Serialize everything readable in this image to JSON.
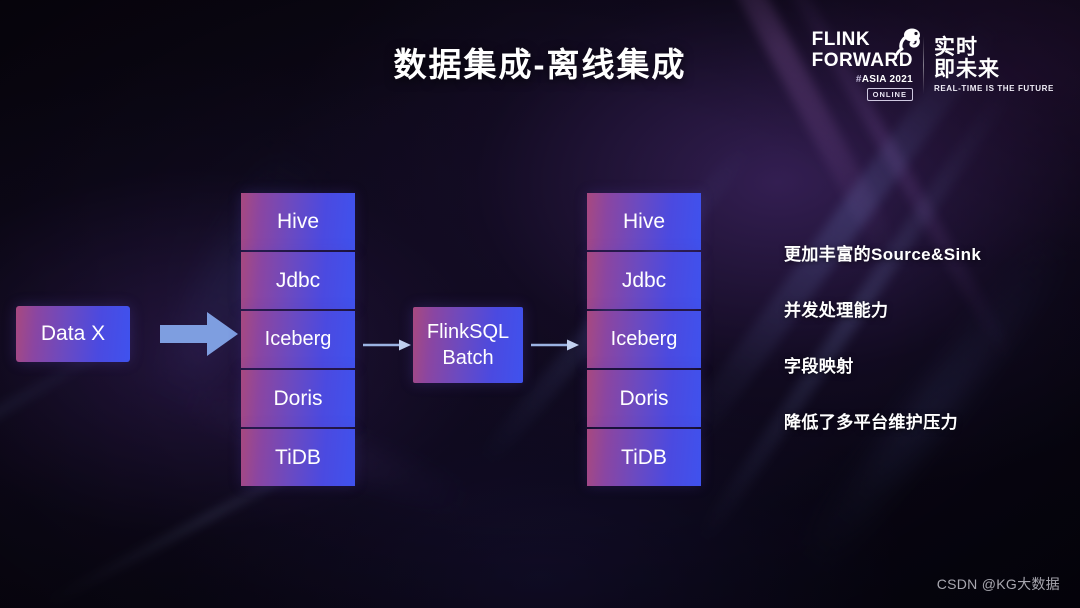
{
  "slide": {
    "title": "数据集成-离线集成",
    "watermark": "CSDN @KG大数据"
  },
  "logo": {
    "word1": "FLINK",
    "word2": "FORWARD",
    "hash": "#",
    "event": "ASIA 2021",
    "online": "ONLINE",
    "cn_line1": "实时",
    "cn_line2": "即未来",
    "tagline": "REAL-TIME IS THE FUTURE"
  },
  "diagram": {
    "source_box": "Data X",
    "engine_box_line1": "FlinkSQL",
    "engine_box_line2": "Batch",
    "left_stack": [
      {
        "label": "Hive"
      },
      {
        "label": "Jdbc"
      },
      {
        "label": "Iceberg"
      },
      {
        "label": "Doris"
      },
      {
        "label": "TiDB"
      }
    ],
    "right_stack": [
      {
        "label": "Hive"
      },
      {
        "label": "Jdbc"
      },
      {
        "label": "Iceberg"
      },
      {
        "label": "Doris"
      },
      {
        "label": "TiDB"
      }
    ]
  },
  "bullets": [
    {
      "text": "更加丰富的Source&Sink"
    },
    {
      "text": "并发处理能力"
    },
    {
      "text": "字段映射"
    },
    {
      "text": "降低了多平台维护压力"
    }
  ],
  "colors": {
    "tile_gradient_start": "#a8497f",
    "tile_gradient_end": "#3f52ee",
    "arrow_fill": "#7e9ee0",
    "text": "#ffffff",
    "background": "#0b0714"
  }
}
